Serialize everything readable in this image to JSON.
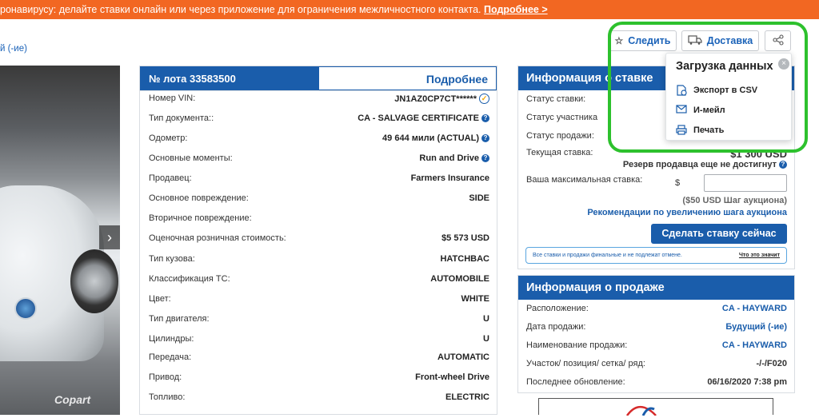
{
  "banner": {
    "text": "ронавирусу: делайте ставки онлайн или через приложение для ограничения межличностного контакта.",
    "link": "Подробнее >"
  },
  "subtitle_link": "й (-ие)",
  "top_buttons": {
    "watch": "Следить",
    "shipping": "Доставка"
  },
  "photo": {
    "watermark": "Copart"
  },
  "lot": {
    "number": "№ лота 33583500",
    "more": "Подробнее",
    "rows": [
      {
        "label": "Номер VIN:",
        "value": "JN1AZ0CP7CT******"
      },
      {
        "label": "Тип документа::",
        "value": "CA - SALVAGE CERTIFICATE"
      },
      {
        "label": "Одометр:",
        "value": "49 644 мили (ACTUAL)"
      },
      {
        "label": "Основные моменты:",
        "value": "Run and Drive"
      },
      {
        "label": "Продавец:",
        "value": "Farmers Insurance"
      },
      {
        "label": "Основное повреждение:",
        "value": "SIDE"
      },
      {
        "label": "Вторичное повреждение:",
        "value": ""
      },
      {
        "label": "Оценочная розничная стоимость:",
        "value": "$5 573 USD"
      },
      {
        "label": "Тип кузова:",
        "value": "HATCHBAC"
      },
      {
        "label": "Классификация ТС:",
        "value": "AUTOMOBILE"
      },
      {
        "label": "Цвет:",
        "value": "WHITE"
      },
      {
        "label": "Тип двигателя:",
        "value": "U"
      },
      {
        "label": "Цилиндры:",
        "value": "U"
      },
      {
        "label": "Передача:",
        "value": "AUTOMATIC"
      },
      {
        "label": "Привод:",
        "value": "Front-wheel Drive"
      },
      {
        "label": "Топливо:",
        "value": "ELECTRIC"
      }
    ]
  },
  "bid": {
    "title": "Информация о ставке",
    "status_bid": "Статус ставки:",
    "status_participant": "Статус участника",
    "status_sale": "Статус продажи:",
    "current_bid_label": "Текущая ставка:",
    "current_bid_value": "$1 300 USD",
    "reserve": "Резерв продавца еще не достигнут",
    "max_bid_label": "Ваша максимальная ставка:",
    "currency": "$",
    "increment": "($50 USD Шаг аукциона)",
    "recommend": "Рекомендации по увеличению шага аукциона",
    "button": "Сделать ставку сейчас",
    "notice": "Все ставки и продажи финальные и не подлежат отмене.",
    "notice_link": "Что это значит"
  },
  "sale": {
    "title": "Информация о продаже",
    "rows": [
      {
        "label": "Расположение:",
        "value": "CA - HAYWARD"
      },
      {
        "label": "Дата продажи:",
        "value": "Будущий (-ие)"
      },
      {
        "label": "Наименование продажи:",
        "value": "CA - HAYWARD"
      },
      {
        "label": "Участок/ позиция/ сетка/ ряд:",
        "value": "-/-/F020"
      },
      {
        "label": "Последнее обновление:",
        "value": "06/16/2020 7:38 pm"
      }
    ]
  },
  "dropdown": {
    "title": "Загрузка данных",
    "items": [
      "Экспорт в CSV",
      "И-мейл",
      "Печать"
    ]
  },
  "colors": {
    "banner": "#f26722",
    "brand_blue": "#1a5dab",
    "highlight_frame": "#2dc12d"
  }
}
